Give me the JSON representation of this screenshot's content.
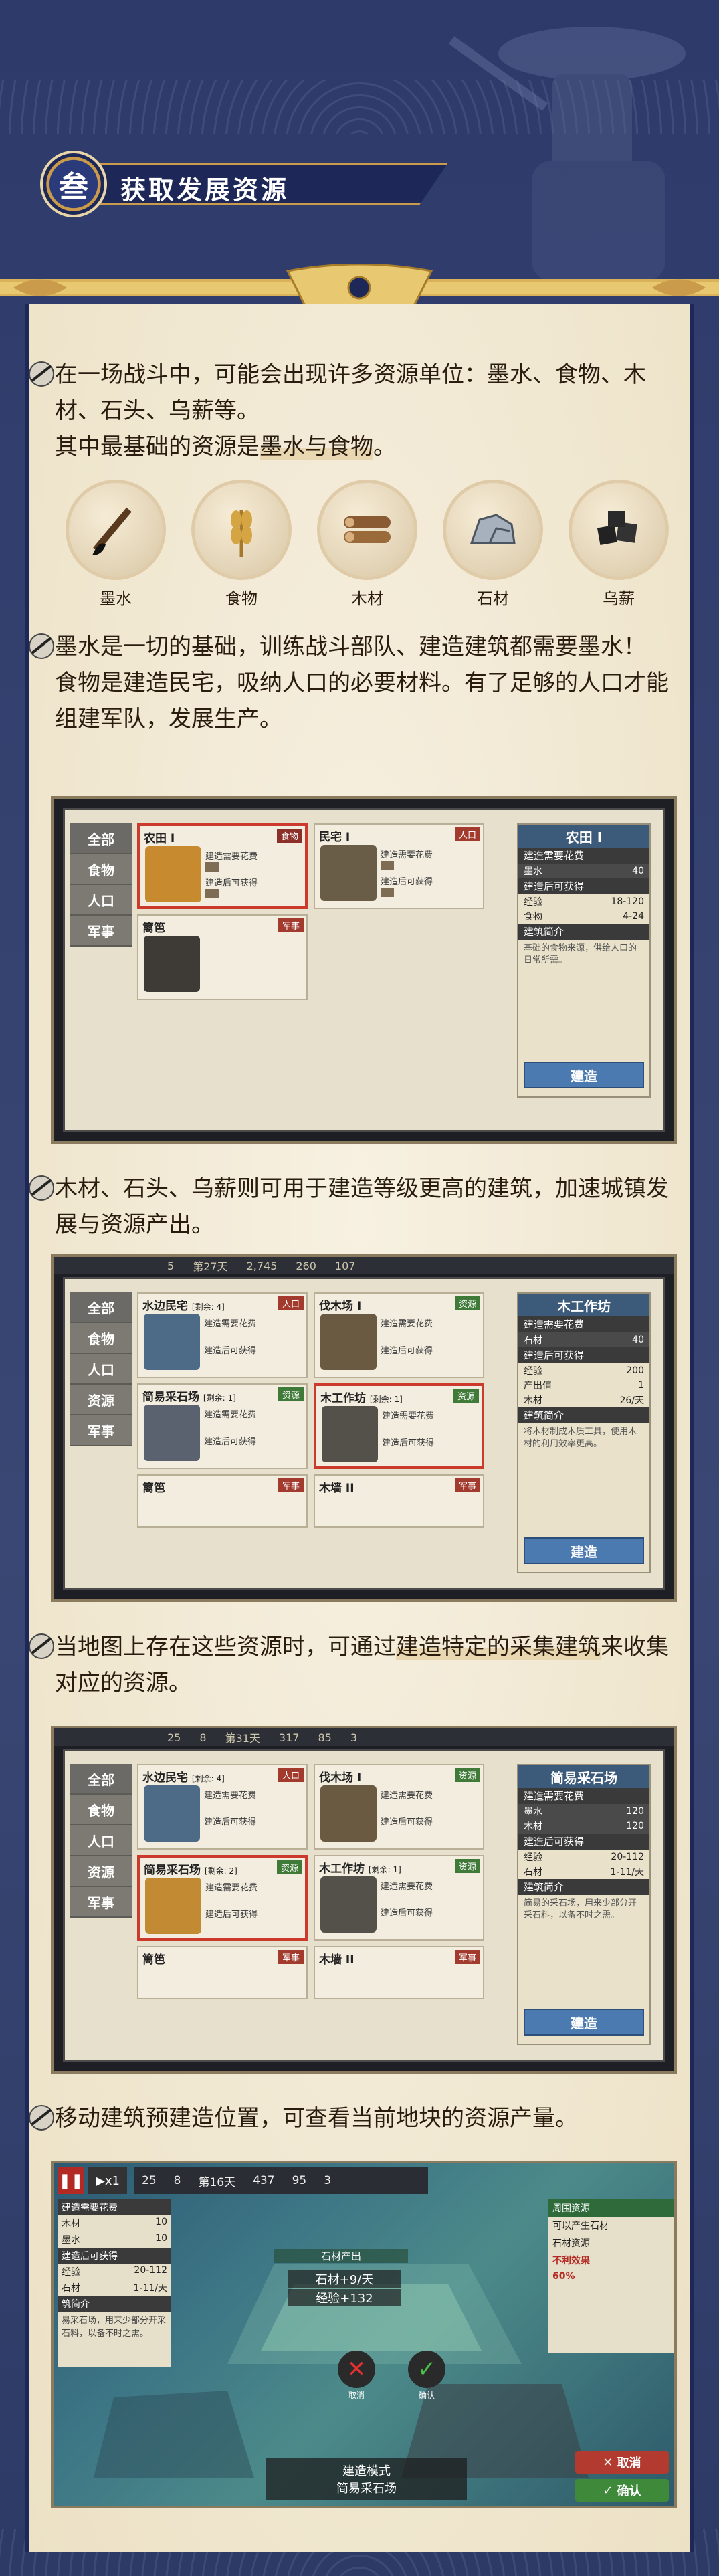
{
  "header": {
    "section_number": "叁",
    "title": "获取发展资源"
  },
  "intro": {
    "line1": "在一场战斗中，可能会出现许多资源单位：墨水、食物、木材、石头、乌薪等。",
    "line2_prefix": "其中最基础的资源是",
    "line2_highlight": "墨水与食物",
    "line2_suffix": "。"
  },
  "resources": [
    {
      "icon": "ink-brush-icon",
      "label": "墨水"
    },
    {
      "icon": "wheat-icon",
      "label": "食物"
    },
    {
      "icon": "wood-log-icon",
      "label": "木材"
    },
    {
      "icon": "stone-icon",
      "label": "石材"
    },
    {
      "icon": "coal-icon",
      "label": "乌薪"
    }
  ],
  "para2": {
    "line1": "墨水是一切的基础，训练战斗部队、建造建筑都需要墨水！",
    "line2": "食物是建造民宅，吸纳人口的必要材料。有了足够的人口才能组建军队，发展生产。"
  },
  "shot1": {
    "categories": [
      "全部",
      "食物",
      "人口",
      "军事"
    ],
    "cards": [
      {
        "title": "农田 I",
        "tag": "食物",
        "l1": "建造需要花费",
        "l2": "建造后可获得"
      },
      {
        "title": "民宅 I",
        "tag": "人口",
        "l1": "建造需要花费",
        "l2": "建造后可获得"
      },
      {
        "title": "篱笆",
        "tag": "军事",
        "l1": "",
        "l2": ""
      }
    ],
    "side": {
      "title": "农田 I",
      "cost_header": "建造需要花费",
      "cost": [
        {
          "name": "墨水",
          "value": "40"
        }
      ],
      "gain_header": "建造后可获得",
      "gain": [
        {
          "name": "经验",
          "value": "18-120"
        },
        {
          "name": "食物",
          "value": "4-24"
        }
      ],
      "desc_title": "建筑简介",
      "desc": "基础的食物来源，供给人口的日常所需。",
      "build_label": "建造"
    }
  },
  "para3": {
    "line1": "木材、石头、乌薪则可用于建造等级更高的建筑，加速城镇发展与资源产出。"
  },
  "shot2": {
    "topbar": [
      "5",
      "第27天",
      "2,745",
      "260",
      "107"
    ],
    "categories": [
      "全部",
      "食物",
      "人口",
      "资源",
      "军事"
    ],
    "cards": [
      {
        "title": "水边民宅",
        "sub": "[剩余: 4]",
        "tag": "人口",
        "l1": "建造需要花费",
        "l2": "建造后可获得"
      },
      {
        "title": "伐木场 I",
        "sub": "",
        "tag": "资源",
        "l1": "建造需要花费",
        "l2": "建造后可获得"
      },
      {
        "title": "简易采石场",
        "sub": "[剩余: 1]",
        "tag": "资源",
        "l1": "建造需要花费",
        "l2": "建造后可获得"
      },
      {
        "title": "木工作坊",
        "sub": "[剩余: 1]",
        "tag": "资源",
        "l1": "建造需要花费",
        "l2": "建造后可获得"
      },
      {
        "title": "篱笆",
        "sub": "",
        "tag": "军事",
        "l1": "",
        "l2": ""
      },
      {
        "title": "木墙 II",
        "sub": "",
        "tag": "军事",
        "l1": "",
        "l2": ""
      }
    ],
    "side": {
      "title": "木工作坊",
      "cost_header": "建造需要花费",
      "cost": [
        {
          "name": "石材",
          "value": "40"
        }
      ],
      "gain_header": "建造后可获得",
      "gain": [
        {
          "name": "经验",
          "value": "200"
        },
        {
          "name": "产出值",
          "value": "1"
        },
        {
          "name": "木材",
          "value": "26/天"
        }
      ],
      "desc_title": "建筑简介",
      "desc": "将木材制成木质工具，使用木材的利用效率更高。",
      "build_label": "建造"
    }
  },
  "para4": {
    "line1_prefix": "当地图上存在这些资源时，可通过",
    "line1_highlight": "建造特定的采集建筑",
    "line1_suffix": "来收集对应的资源。"
  },
  "shot3": {
    "topbar": [
      "25",
      "8",
      "第31天",
      "317",
      "85",
      "3"
    ],
    "categories": [
      "全部",
      "食物",
      "人口",
      "资源",
      "军事"
    ],
    "cards": [
      {
        "title": "水边民宅",
        "sub": "[剩余: 4]",
        "tag": "人口",
        "l1": "建造需要花费",
        "l2": "建造后可获得"
      },
      {
        "title": "伐木场 I",
        "sub": "",
        "tag": "资源",
        "l1": "建造需要花费",
        "l2": "建造后可获得"
      },
      {
        "title": "简易采石场",
        "sub": "[剩余: 2]",
        "tag": "资源",
        "l1": "建造需要花费",
        "l2": "建造后可获得"
      },
      {
        "title": "木工作坊",
        "sub": "[剩余: 1]",
        "tag": "资源",
        "l1": "建造需要花费",
        "l2": "建造后可获得"
      },
      {
        "title": "篱笆",
        "sub": "",
        "tag": "军事",
        "l1": "",
        "l2": ""
      },
      {
        "title": "木墙 II",
        "sub": "",
        "tag": "军事",
        "l1": "",
        "l2": ""
      }
    ],
    "side": {
      "title": "简易采石场",
      "cost_header": "建造需要花费",
      "cost": [
        {
          "name": "墨水",
          "value": "120"
        },
        {
          "name": "木材",
          "value": "120"
        }
      ],
      "gain_header": "建造后可获得",
      "gain": [
        {
          "name": "经验",
          "value": "20-112"
        },
        {
          "name": "石材",
          "value": "1-11/天"
        }
      ],
      "desc_title": "建筑简介",
      "desc": "简易的采石场，用来少部分开采石料，以备不时之需。",
      "build_label": "建造"
    }
  },
  "para5": {
    "line1": "移动建筑预建造位置，可查看当前地块的资源产量。"
  },
  "shot4": {
    "speed": "x1",
    "topbar": [
      "25",
      "8",
      "第16天",
      "437",
      "95",
      "3"
    ],
    "left_panel": {
      "cost_header": "建造需要花费",
      "cost": [
        {
          "name": "木材",
          "value": "10"
        },
        {
          "name": "墨水",
          "value": "10"
        }
      ],
      "gain_header": "建造后可获得",
      "gain": [
        {
          "name": "经验",
          "value": "20-112"
        },
        {
          "name": "石材",
          "value": "1-11/天"
        }
      ],
      "desc_title": "筑简介",
      "desc": "易采石场，用来少部分开采石料，以备不时之需。"
    },
    "tile_labels": [
      "石材产出",
      "石材+9/天",
      "经验+132"
    ],
    "right_panel": {
      "title": "周围资源",
      "lines": [
        "可以产生石材",
        "石材资源"
      ],
      "warn": "不利效果",
      "percent": "60%"
    },
    "mode_label": "建造模式",
    "building_label": "简易采石场",
    "cancel_label": "取消",
    "confirm_label": "确认",
    "cancel_short": "取消",
    "confirm_short": "确认"
  }
}
